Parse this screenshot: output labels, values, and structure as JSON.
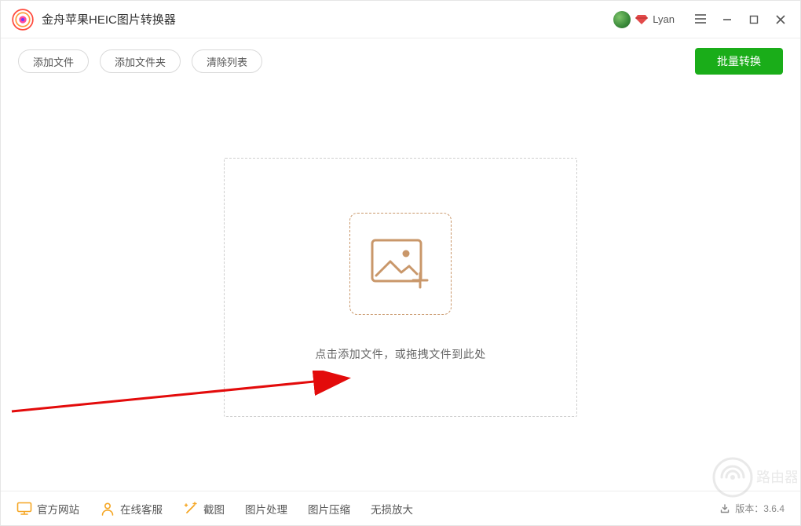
{
  "app": {
    "title": "金舟苹果HEIC图片转换器"
  },
  "user": {
    "name": "Lyan"
  },
  "toolbar": {
    "add_file": "添加文件",
    "add_folder": "添加文件夹",
    "clear_list": "清除列表",
    "batch_convert": "批量转换"
  },
  "dropzone": {
    "hint": "点击添加文件，或拖拽文件到此处"
  },
  "bottom": {
    "official_site": "官方网站",
    "online_service": "在线客服",
    "screenshot": "截图",
    "image_process": "图片处理",
    "image_compress": "图片压缩",
    "lossless_enlarge": "无损放大",
    "version_label": "版本：",
    "version_value": "3.6.4"
  },
  "watermark": {
    "text": "路由器"
  }
}
